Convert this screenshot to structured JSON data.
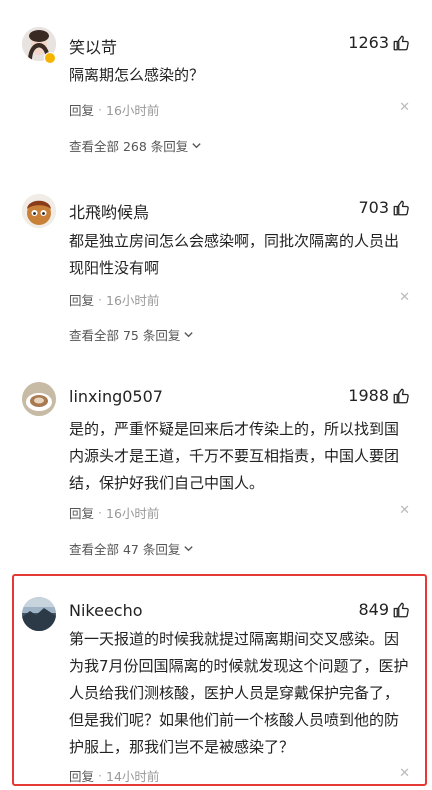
{
  "comments": [
    {
      "username": "笑以苛",
      "likes": "1263",
      "text": "隔离期怎么感染的？",
      "reply_label": "回复",
      "time": "16小时前",
      "view_all": "查看全部 268 条回复"
    },
    {
      "username": "北飛哟候鳥",
      "likes": "703",
      "text": "都是独立房间怎么会感染啊，同批次隔离的人员出现阳性没有啊",
      "reply_label": "回复",
      "time": "16小时前",
      "view_all": "查看全部 75 条回复"
    },
    {
      "username": "linxing0507",
      "likes": "1988",
      "text": "是的，严重怀疑是回来后才传染上的，所以找到国内源头才是王道，千万不要互相指责，中国人要团结，保护好我们自己中国人。",
      "reply_label": "回复",
      "time": "16小时前",
      "view_all": "查看全部 47 条回复"
    },
    {
      "username": "Nikeecho",
      "likes": "849",
      "text": "第一天报道的时候我就提过隔离期间交叉感染。因为我7月份回国隔离的时候就发现这个问题了，医护人员给我们测核酸，医护人员是穿戴保护完备了，但是我们呢？如果他们前一个核酸人员喷到他的防护服上，那我们岂不是被感染了？",
      "reply_label": "回复",
      "time": "14小时前"
    }
  ],
  "colors": {
    "highlight_border": "#e53935",
    "meta_text": "#999999",
    "badge": "#f5b400"
  },
  "icons": {
    "like": "thumbs-up-icon",
    "close": "close-icon",
    "expand": "chevron-down-icon"
  }
}
